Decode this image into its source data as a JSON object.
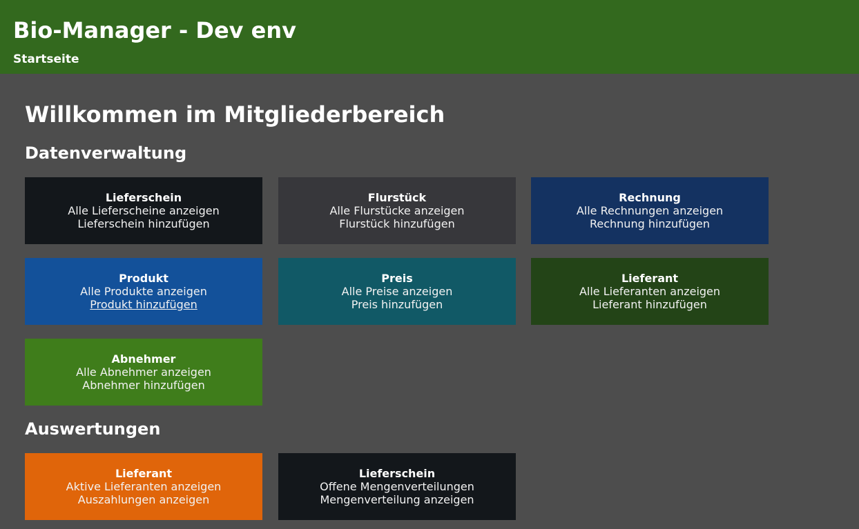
{
  "header": {
    "app_title": "Bio-Manager - Dev env",
    "breadcrumb": "Startseite",
    "background_color": "#33691e"
  },
  "main": {
    "page_title": "Willkommen im Mitgliederbereich",
    "sections": [
      {
        "title": "Datenverwaltung",
        "cards": [
          {
            "title": "Lieferschein",
            "links": [
              "Alle Lieferscheine anzeigen",
              "Lieferschein hinzufügen"
            ],
            "color": "#13171b"
          },
          {
            "title": "Flurstück",
            "links": [
              "Alle Flurstücke anzeigen",
              "Flurstück hinzufügen"
            ],
            "color": "#37373b"
          },
          {
            "title": "Rechnung",
            "links": [
              "Alle Rechnungen anzeigen",
              "Rechnung hinzufügen"
            ],
            "color": "#143261"
          },
          {
            "title": "Produkt",
            "links": [
              "Alle Produkte anzeigen",
              "Produkt hinzufügen"
            ],
            "color": "#13519a",
            "hovered_link_index": 1
          },
          {
            "title": "Preis",
            "links": [
              "Alle Preise anzeigen",
              "Preis hinzufügen"
            ],
            "color": "#115966"
          },
          {
            "title": "Lieferant",
            "links": [
              "Alle Lieferanten anzeigen",
              "Lieferant hinzufügen"
            ],
            "color": "#234417"
          },
          {
            "title": "Abnehmer",
            "links": [
              "Alle Abnehmer anzeigen",
              "Abnehmer hinzufügen"
            ],
            "color": "#3f7d1b"
          }
        ]
      },
      {
        "title": "Auswertungen",
        "cards": [
          {
            "title": "Lieferant",
            "links": [
              "Aktive Lieferanten anzeigen",
              "Auszahlungen anzeigen"
            ],
            "color": "#e0650a"
          },
          {
            "title": "Lieferschein",
            "links": [
              "Offene Mengenverteilungen",
              "Mengenverteilung anzeigen"
            ],
            "color": "#13171b"
          }
        ]
      }
    ]
  }
}
